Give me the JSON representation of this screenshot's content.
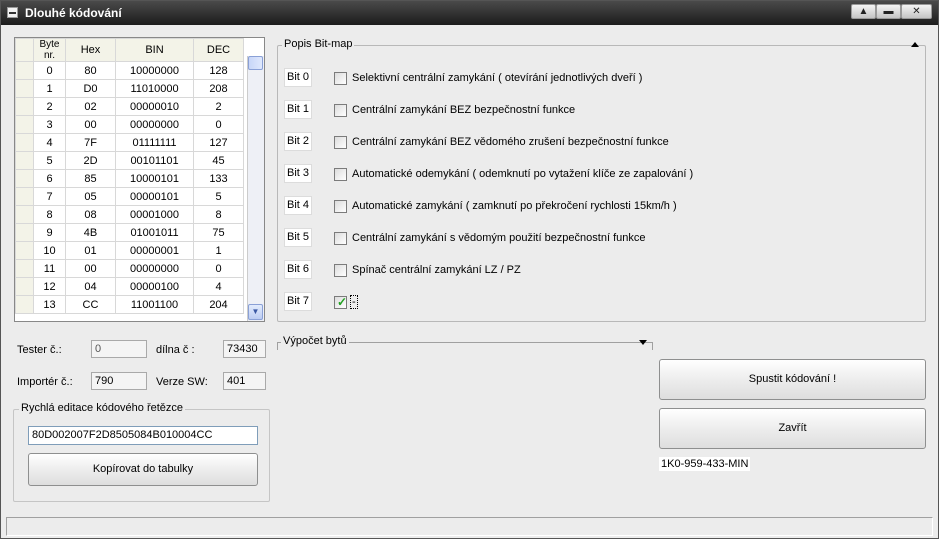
{
  "window": {
    "title": "Dlouhé kódování"
  },
  "titlebar_buttons": {
    "restore": "▲",
    "minimize": "▬",
    "close": "✕"
  },
  "grid": {
    "headers": {
      "byte": "Byte nr.",
      "hex": "Hex",
      "bin": "BIN",
      "dec": "DEC"
    },
    "rows": [
      {
        "byte": "0",
        "hex": "80",
        "bin": "10000000",
        "dec": "128"
      },
      {
        "byte": "1",
        "hex": "D0",
        "bin": "11010000",
        "dec": "208"
      },
      {
        "byte": "2",
        "hex": "02",
        "bin": "00000010",
        "dec": "2"
      },
      {
        "byte": "3",
        "hex": "00",
        "bin": "00000000",
        "dec": "0"
      },
      {
        "byte": "4",
        "hex": "7F",
        "bin": "01111111",
        "dec": "127"
      },
      {
        "byte": "5",
        "hex": "2D",
        "bin": "00101101",
        "dec": "45"
      },
      {
        "byte": "6",
        "hex": "85",
        "bin": "10000101",
        "dec": "133"
      },
      {
        "byte": "7",
        "hex": "05",
        "bin": "00000101",
        "dec": "5"
      },
      {
        "byte": "8",
        "hex": "08",
        "bin": "00001000",
        "dec": "8"
      },
      {
        "byte": "9",
        "hex": "4B",
        "bin": "01001011",
        "dec": "75"
      },
      {
        "byte": "10",
        "hex": "01",
        "bin": "00000001",
        "dec": "1"
      },
      {
        "byte": "11",
        "hex": "00",
        "bin": "00000000",
        "dec": "0"
      },
      {
        "byte": "12",
        "hex": "04",
        "bin": "00000100",
        "dec": "4"
      },
      {
        "byte": "13",
        "hex": "CC",
        "bin": "11001100",
        "dec": "204"
      }
    ]
  },
  "info": {
    "tester_label": "Tester č.:",
    "tester_value": "0",
    "dilna_label": "dílna č :",
    "dilna_value": "73430",
    "importer_label": "Importér č.:",
    "importer_value": "790",
    "verze_label": "Verze SW:",
    "verze_value": "401"
  },
  "quick_edit": {
    "title": "Rychlá editace kódového řetězce",
    "value": "80D002007F2D8505084B010004CC",
    "copy_button": "Kopírovat do tabulky"
  },
  "bitmap": {
    "title": "Popis Bit-map",
    "bits": [
      {
        "tag": "Bit 0",
        "label": "Selektivní centrální zamykání ( otevírání jednotlivých dveří )",
        "checked": false
      },
      {
        "tag": "Bit 1",
        "label": "Centrální zamykání BEZ bezpečnostní funkce",
        "checked": false
      },
      {
        "tag": "Bit 2",
        "label": "Centrální zamykání BEZ vědomého zrušení bezpečnostní funkce",
        "checked": false
      },
      {
        "tag": "Bit 3",
        "label": "Automatické odemykání ( odemknutí po vytažení klíče ze zapalování )",
        "checked": false
      },
      {
        "tag": "Bit 4",
        "label": "Automatické zamykání ( zamknutí po překročení rychlosti 15km/h )",
        "checked": false
      },
      {
        "tag": "Bit 5",
        "label": "Centrální zamykání s vědomým použití  bezpečnostní funkce",
        "checked": false
      },
      {
        "tag": "Bit 6",
        "label": "Spínač centrální zamykání LZ / PZ",
        "checked": false
      },
      {
        "tag": "Bit 7",
        "label": "-",
        "checked": true
      }
    ]
  },
  "vypocet": {
    "title": "Výpočet bytů"
  },
  "actions": {
    "start_button": "Spustit kódování !",
    "close_button": "Zavřít",
    "part_number": "1K0-959-433-MIN"
  }
}
